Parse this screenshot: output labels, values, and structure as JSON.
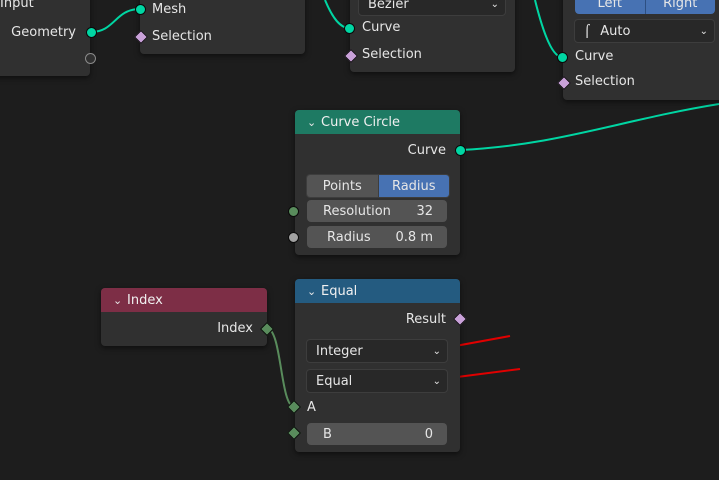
{
  "nodes": {
    "input": {
      "title": "Input",
      "outputs": {
        "geometry": "Geometry"
      }
    },
    "mesh_node": {
      "inputs": {
        "mesh": "Mesh",
        "selection": "Selection"
      }
    },
    "curve_node": {
      "mode": "Bezier",
      "inputs": {
        "curve": "Curve",
        "selection": "Selection"
      }
    },
    "set_handle": {
      "side_left": "Left",
      "side_right": "Right",
      "handle_type": "Auto",
      "inputs": {
        "curve": "Curve",
        "selection": "Selection"
      }
    },
    "curve_circle": {
      "title": "Curve Circle",
      "output": "Curve",
      "mode_points": "Points",
      "mode_radius": "Radius",
      "resolution_label": "Resolution",
      "resolution_value": "32",
      "radius_label": "Radius",
      "radius_value": "0.8 m"
    },
    "index": {
      "title": "Index",
      "output": "Index"
    },
    "equal": {
      "title": "Equal",
      "output": "Result",
      "data_type": "Integer",
      "operation": "Equal",
      "input_a": "A",
      "input_b_label": "B",
      "input_b_value": "0"
    }
  },
  "colors": {
    "curve_circle_header": "#1e7a63",
    "index_header": "#7d2e46",
    "equal_header": "#245b80",
    "geometry_socket": "#00d6a3",
    "field_socket": "#c9a1d9",
    "int_socket": "#598c5c",
    "float_socket": "#a1a1a1",
    "active_button": "#4772b3",
    "annotation_arrow": "#e00000"
  }
}
